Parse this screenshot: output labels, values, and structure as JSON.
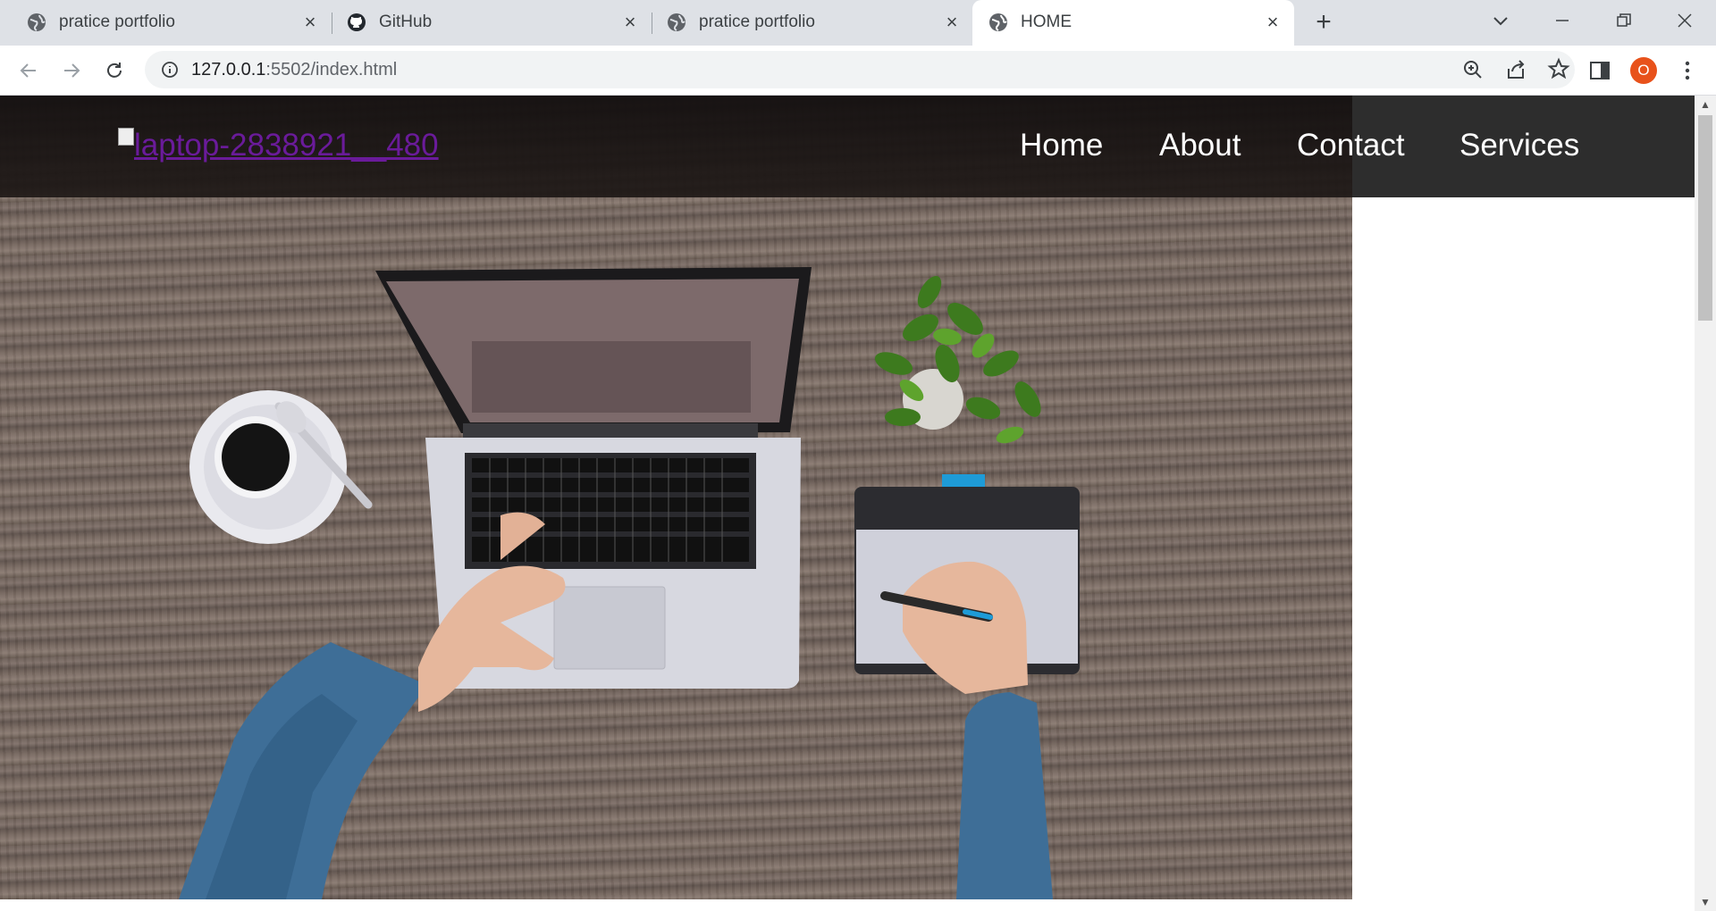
{
  "browser": {
    "tabs": [
      {
        "title": "pratice portfolio",
        "icon": "globe-icon"
      },
      {
        "title": "GitHub",
        "icon": "github-icon"
      },
      {
        "title": "pratice portfolio",
        "icon": "globe-icon"
      },
      {
        "title": "HOME",
        "icon": "globe-icon",
        "active": true
      }
    ],
    "url_host": "127.0.0.1",
    "url_rest": ":5502/index.html",
    "profile_initial": "O"
  },
  "page": {
    "logo_alt": "laptop-2838921__480",
    "nav": [
      "Home",
      "About",
      "Contact",
      "Services"
    ]
  },
  "colors": {
    "navbar": "#1c1716",
    "link_visited": "#6a1b9a",
    "avatar": "#e8521b"
  }
}
